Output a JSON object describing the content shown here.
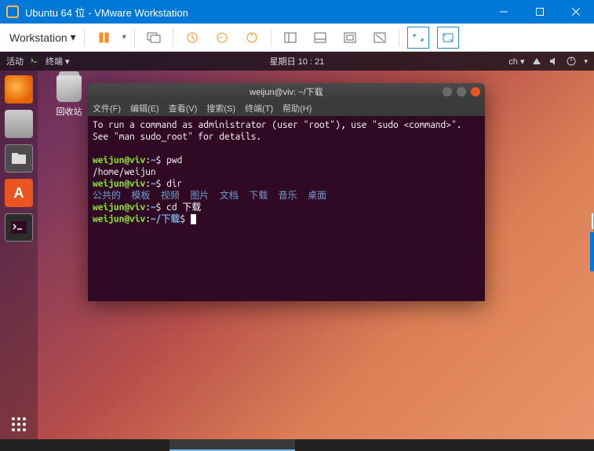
{
  "vmware": {
    "title": "Ubuntu 64 位 - VMware Workstation",
    "workstation_menu": "Workstation"
  },
  "ubuntu_panel": {
    "activities": "活动",
    "app_menu": "终端 ▾",
    "datetime": "星期日 10 : 21",
    "input": "ch ▾"
  },
  "desktop": {
    "trash_label": "回收站"
  },
  "terminal": {
    "title": "weijun@viv: ~/下载",
    "menu": [
      "文件(F)",
      "编辑(E)",
      "查看(V)",
      "搜索(S)",
      "终端(T)",
      "帮助(H)"
    ],
    "output": {
      "line1": "To run a command as administrator (user \"root\"), use \"sudo <command>\".",
      "line2": "See \"man sudo_root\" for details.",
      "blank": "",
      "prompt1_user": "weijun@viv",
      "prompt1_path": "~",
      "cmd1": "pwd",
      "pwd_out": "/home/weijun",
      "cmd2": "dir",
      "dir_out": "公共的  模板  视频  图片  文档  下载  音乐  桌面",
      "cmd3": "cd 下载",
      "prompt4_path": "~/下载",
      "dollar": "$"
    }
  }
}
